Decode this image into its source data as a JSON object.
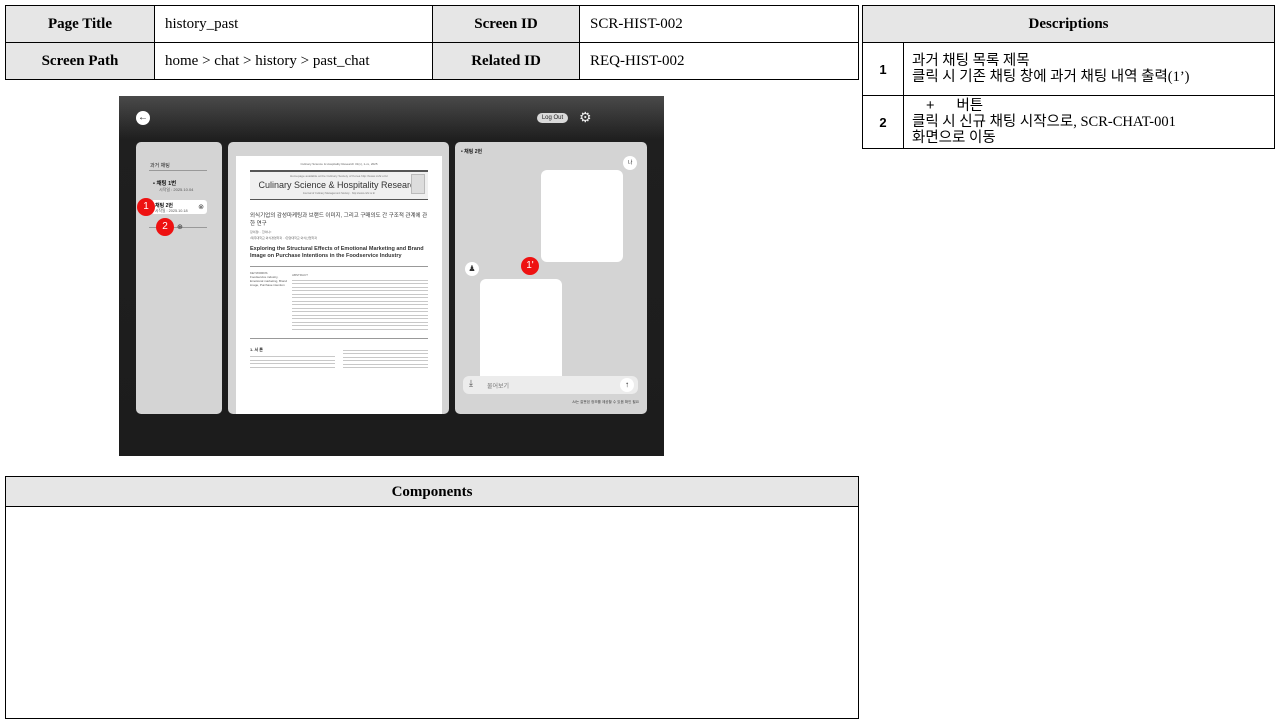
{
  "header": {
    "page_title_label": "Page Title",
    "page_title_value": "history_past",
    "screen_id_label": "Screen ID",
    "screen_id_value": "SCR-HIST-002",
    "screen_path_label": "Screen Path",
    "screen_path_value": "home > chat > history > past_chat",
    "related_id_label": "Related ID",
    "related_id_value": "REQ-HIST-002"
  },
  "descriptions": {
    "title": "Descriptions",
    "items": [
      {
        "num": "1",
        "line1": "과거 채팅 목록 제목",
        "line2": "클릭 시 기존 채팅 창에 과거 채팅 내역 출력(1’)"
      },
      {
        "num": "2",
        "plus": "+",
        "line1": "버튼",
        "line2": "클릭 시 신규 채팅 시작으로, SCR-CHAT-001",
        "line3": "화면으로 이동"
      }
    ]
  },
  "components": {
    "title": "Components"
  },
  "screen": {
    "back_icon": "arrow-left-icon",
    "logout_label": "Log Out",
    "settings_icon": "gear-icon",
    "sidebar": {
      "title": "과거 채팅",
      "items": [
        {
          "title": "• 채팅 1번",
          "date": "시작일 : 2025.10.04"
        },
        {
          "title": "채팅 2번",
          "date": "시작일 : 2025.10.18"
        }
      ],
      "new_chat_icon": "plus-icon"
    },
    "paper": {
      "header_line": "Culinary Science & Hospitality Research 31(x), 1-xx, 2025",
      "avail_line": "Homepage available at the Culinary Society of Korea http://www.cshr.or.kr",
      "journal_title": "Culinary Science & Hospitality Research",
      "journal_url": "Journal of Culinary Management Society · http://www.cshr.or.kr",
      "korean_title": "외식기업의 감성마케팅과 브랜드 이미지, 그리고 구매의도 간 구조적 관계에 관한 연구",
      "authors": "장이정¹ · 한이나²",
      "affiliation": "¹제주대학교 외식경영학과 · ²한양대학교 외식산업학과",
      "english_title": "Exploring the Structural Effects of Emotional Marketing and Brand Image on Purchase Intentions in the Foodservice Industry",
      "keywords_label": "KEYWORDS",
      "keywords": "Foodservice industry, Emotional marketing, Brand image, Purchase intention",
      "abstract_label": "ABSTRACT",
      "section_title": "1. 서 론"
    },
    "chat": {
      "title": "• 채팅 2번",
      "me_label": "나",
      "input_placeholder": "물어보기",
      "download_icon": "download-icon",
      "send_icon": "arrow-up-icon",
      "disclaimer": "AI는 잘못된 정보를 제공할 수 있음 확인 필요"
    }
  },
  "markers": {
    "m1": "1",
    "m1p": "1'",
    "m2": "2"
  }
}
